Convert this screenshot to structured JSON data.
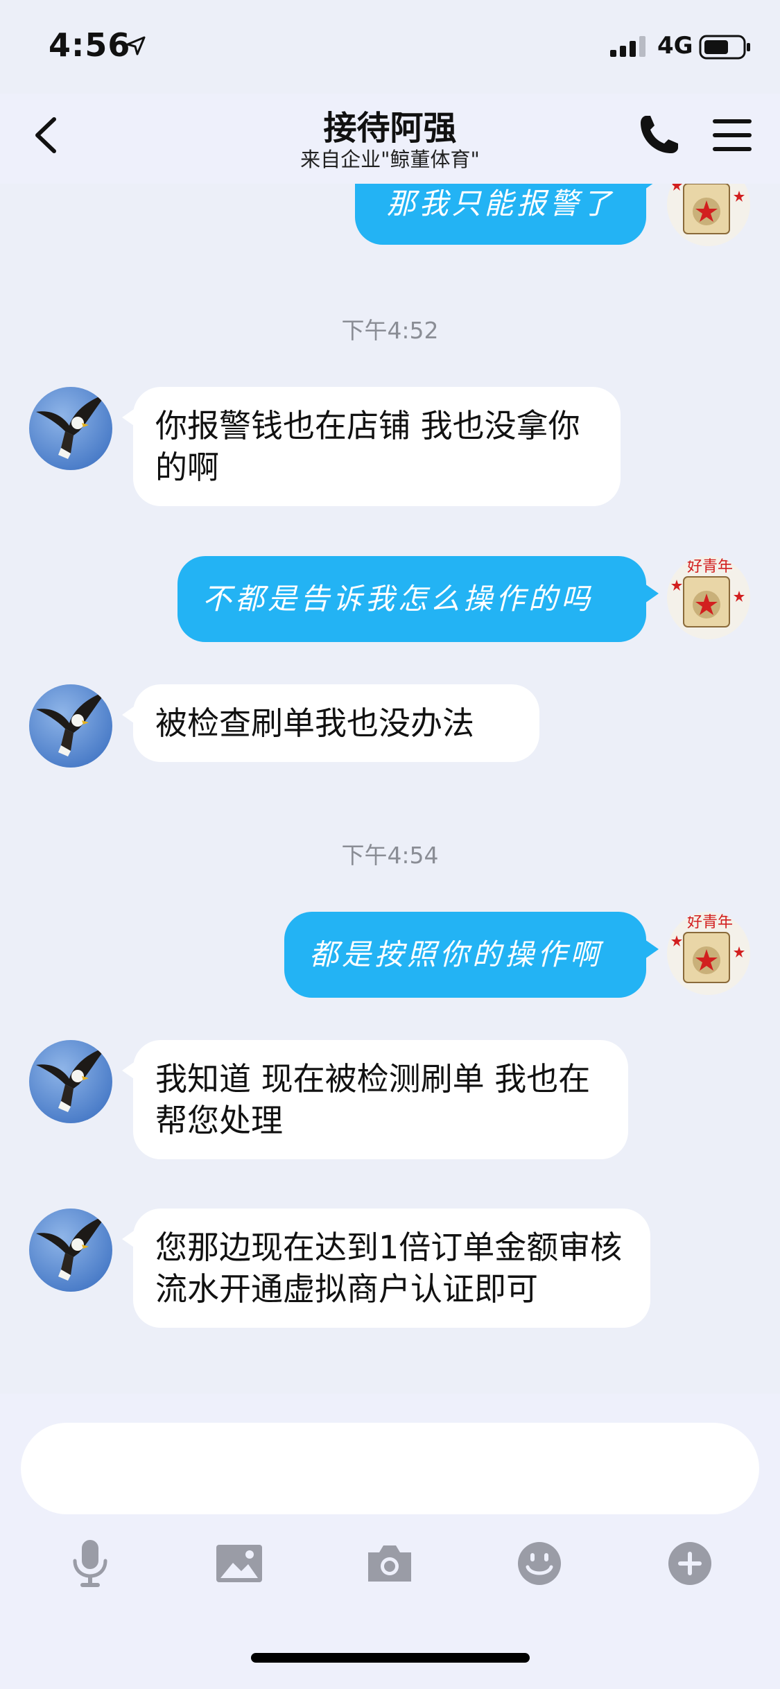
{
  "status_bar": {
    "time": "4:56",
    "network": "4G"
  },
  "header": {
    "title": "接待阿强",
    "subtitle": "来自企业\"鲸董体育\""
  },
  "messages": [
    {
      "from": "me",
      "text": "那我只能报警了"
    },
    {
      "from": "them",
      "text": "你报警钱也在店铺 我也没拿你的啊"
    },
    {
      "from": "me",
      "text": "不都是告诉我怎么操作的吗"
    },
    {
      "from": "them",
      "text": "被检查刷单我也没办法"
    },
    {
      "from": "me",
      "text": "都是按照你的操作啊"
    },
    {
      "from": "them",
      "text": "我知道 现在被检测刷单 我也在帮您处理"
    },
    {
      "from": "them",
      "text": "您那边现在达到1倍订单金额审核流水开通虚拟商户认证即可"
    }
  ],
  "timestamps": [
    "下午4:52",
    "下午4:54"
  ],
  "avatar_badge_text": "好青年",
  "input": {
    "value": ""
  },
  "toolbar": {
    "icons": [
      "microphone-icon",
      "image-icon",
      "camera-icon",
      "emoji-icon",
      "plus-icon"
    ]
  },
  "colors": {
    "outgoing_bubble": "#23b3f4",
    "background": "#eceff8",
    "icon_gray": "#9a9ca6"
  }
}
